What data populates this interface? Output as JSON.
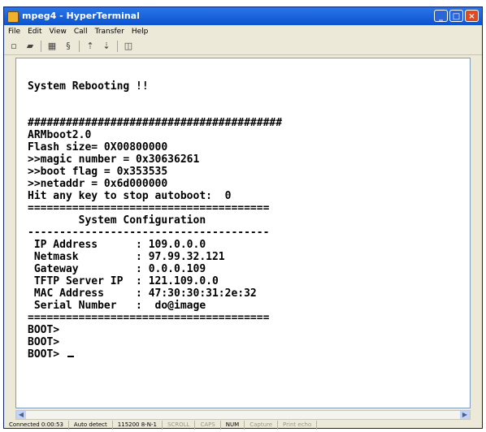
{
  "window": {
    "title": "mpeg4 - HyperTerminal"
  },
  "menu": [
    "File",
    "Edit",
    "View",
    "Call",
    "Transfer",
    "Help"
  ],
  "toolbar": {
    "icons": [
      "new-icon",
      "open-icon",
      "disconnect-icon",
      "properties-icon",
      "send-icon",
      "receive-icon",
      "settings-icon"
    ]
  },
  "terminal": {
    "lines": [
      "System Rebooting !!",
      "",
      "",
      "########################################",
      "ARMboot2.0",
      "Flash size= 0X00800000",
      ">>magic number = 0x30636261",
      ">>boot flag = 0x353535",
      ">>netaddr = 0x6d000000",
      "Hit any key to stop autoboot:  0",
      "======================================",
      "        System Configuration",
      "--------------------------------------",
      " IP Address      : 109.0.0.0",
      " Netmask         : 97.99.32.121",
      " Gateway         : 0.0.0.109",
      " TFTP Server IP  : 121.109.0.0",
      " MAC Address     : 47:30:30:31:2e:32",
      " Serial Number   :  do@image",
      "======================================",
      "BOOT>",
      "BOOT>",
      "BOOT> "
    ]
  },
  "status": {
    "connected": "Connected 0:00:53",
    "detect": "Auto detect",
    "settings": "115200 8-N-1",
    "scroll": "SCROLL",
    "caps": "CAPS",
    "num": "NUM",
    "capture": "Capture",
    "print_echo": "Print echo"
  }
}
